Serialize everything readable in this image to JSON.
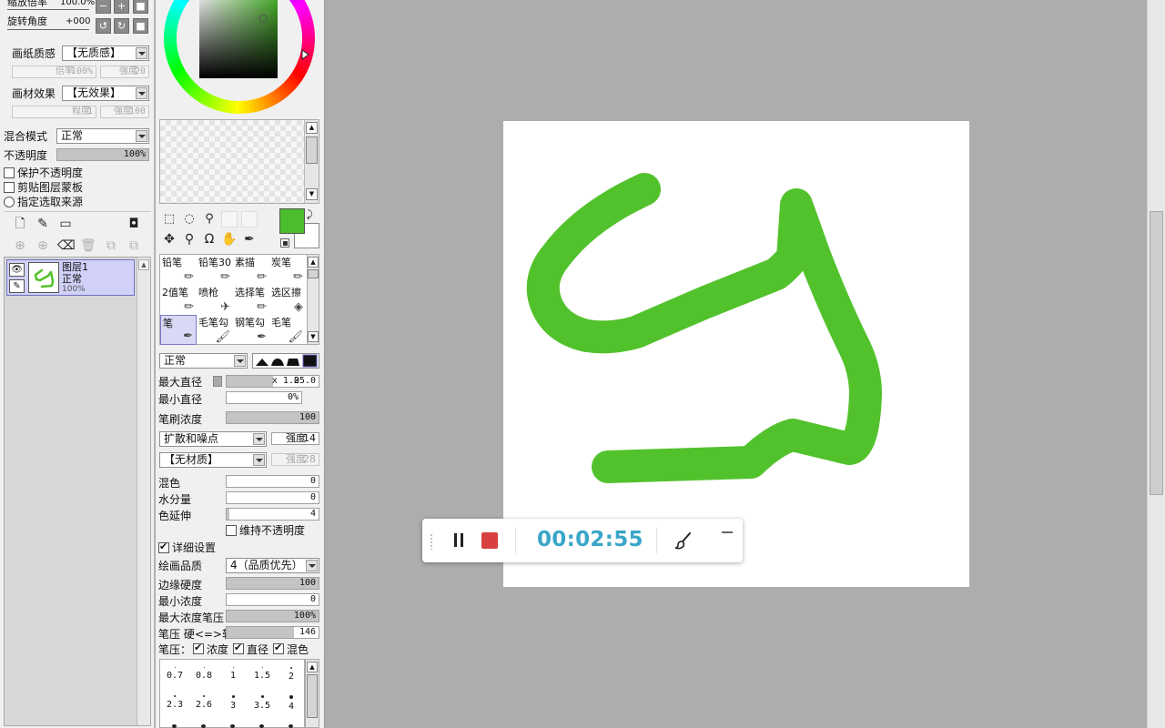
{
  "navigator": {
    "zoom_label": "缩放倍率",
    "zoom_value": "100.0%",
    "rotate_label": "旋转角度",
    "rotate_value": "+000"
  },
  "paper": {
    "texture_label": "画纸质感",
    "texture_value": "【无质感】",
    "texture_scale_label": "倍率",
    "texture_scale_value": "100%",
    "texture_strength_label": "强度",
    "texture_strength_value": "20",
    "effect_label": "画材效果",
    "effect_value": "【无效果】",
    "effect_degree_label": "程度",
    "effect_degree_value": "1",
    "effect_strength_label": "强度",
    "effect_strength_value": "100"
  },
  "layer_props": {
    "blend_label": "混合模式",
    "blend_value": "正常",
    "opacity_label": "不透明度",
    "opacity_value": "100%",
    "opacity_fraction": 1.0,
    "protect_opacity": "保护不透明度",
    "clip_mask": "剪贴图层蒙板",
    "selection_source": "指定选取来源"
  },
  "layers": [
    {
      "name": "图层1",
      "mode": "正常",
      "opacity": "100%"
    }
  ],
  "colors": {
    "foreground": "#4cbd2d",
    "background": "#ffffff",
    "stroke": "#52c22c",
    "timer": "#3aa6c8",
    "stop": "#d84040"
  },
  "brushes": [
    {
      "label": "铅笔",
      "icon": "pencil-icon"
    },
    {
      "label": "铅笔30",
      "icon": "pencil-icon"
    },
    {
      "label": "素描",
      "icon": "pencil-icon"
    },
    {
      "label": "炭笔",
      "icon": "pencil-icon"
    },
    {
      "label": "2值笔",
      "icon": "pencil-icon"
    },
    {
      "label": "喷枪",
      "icon": "airbrush-icon"
    },
    {
      "label": "选择笔",
      "icon": "pencil-icon"
    },
    {
      "label": "选区擦",
      "icon": "eraser-icon"
    },
    {
      "label": "笔",
      "icon": "pen-icon"
    },
    {
      "label": "毛笔勾",
      "icon": "brush-icon"
    },
    {
      "label": "钢笔勾",
      "icon": "pen-icon"
    },
    {
      "label": "毛笔",
      "icon": "brush-icon"
    }
  ],
  "brush_settings": {
    "mode_value": "正常",
    "max_size_label": "最大直径",
    "max_size_mult": "x 1.0",
    "max_size_value": "25.0",
    "min_size_label": "最小直径",
    "min_size_value": "0%",
    "density_label": "笔刷浓度",
    "density_value": "100",
    "noise_value": "扩散和噪点",
    "noise_strength_label": "强度",
    "noise_strength_value": "14",
    "texture_value": "【无材质】",
    "texture_strength_label": "强度",
    "texture_strength_value": "28",
    "blend_label": "混色",
    "blend_value": "0",
    "water_label": "水分量",
    "water_value": "0",
    "persistence_label": "色延伸",
    "persistence_value": "4",
    "keep_opacity": "维持不透明度",
    "advanced": "详细设置",
    "quality_label": "绘画品质",
    "quality_value": "4（品质优先）",
    "edge_label": "边缘硬度",
    "edge_value": "100",
    "min_density_label": "最小浓度",
    "min_density_value": "0",
    "max_pressure_label": "最大浓度笔压",
    "max_pressure_value": "100%",
    "pressure_label": "笔压 硬<=>软",
    "pressure_value": "146",
    "pressure_prefix": "笔压：",
    "pressure_density": "浓度",
    "pressure_size": "直径",
    "pressure_blend": "混色"
  },
  "sizes_row1": [
    "0.7",
    "0.8",
    "1",
    "1.5",
    "2"
  ],
  "sizes_row2": [
    "2.3",
    "2.6",
    "3",
    "3.5",
    "4"
  ],
  "recorder": {
    "time": "00:02:55",
    "pause_icon": "pause-icon",
    "stop_icon": "stop-icon",
    "brush_icon": "paint-brush-icon",
    "minimize_icon": "minimize-icon"
  }
}
